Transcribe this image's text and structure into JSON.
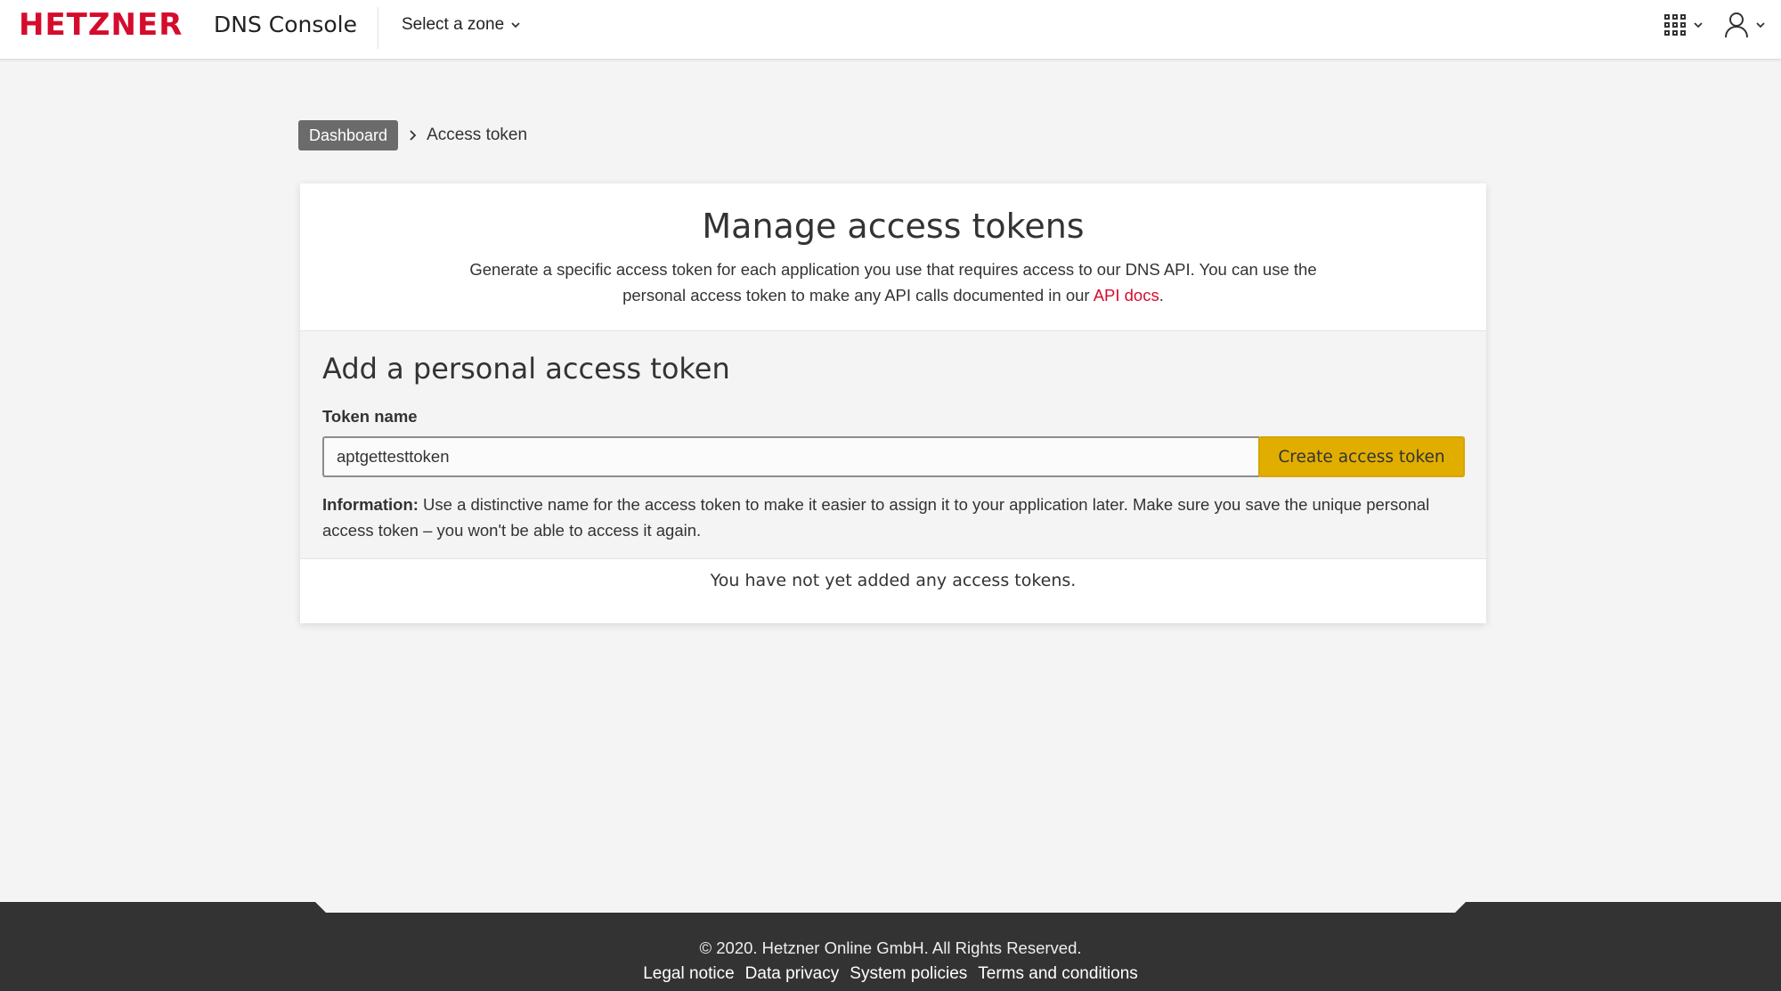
{
  "header": {
    "logo_text": "HETZNER",
    "app_name": "DNS Console",
    "zone_select_label": "Select a zone",
    "apps_menu_icon": "grid-apps-icon",
    "user_menu_icon": "user-icon"
  },
  "breadcrumb": {
    "home_label": "Dashboard",
    "current_label": "Access token"
  },
  "card": {
    "title": "Manage access tokens",
    "description_prefix": "Generate a specific access token for each application you use that requires access to our DNS API. You can use the personal access token to make any API calls documented in our ",
    "description_link": "API docs",
    "description_suffix": "."
  },
  "form": {
    "title": "Add a personal access token",
    "field_label": "Token name",
    "token_value": "aptgettesttoken",
    "submit_label": "Create access token",
    "info_label": "Information:",
    "info_text": " Use a distinctive name for the access token to make it easier to assign it to your application later. Make sure you save the unique personal access token – you won't be able to access it again."
  },
  "empty_state": "You have not yet added any access tokens.",
  "footer": {
    "copyright": "© 2020. Hetzner Online GmbH. All Rights Reserved.",
    "links": [
      "Legal notice",
      "Data privacy",
      "System policies",
      "Terms and conditions"
    ]
  },
  "colors": {
    "brand_red": "#d50c2d",
    "button_yellow": "#e1ae00",
    "footer_dark": "#333333"
  }
}
